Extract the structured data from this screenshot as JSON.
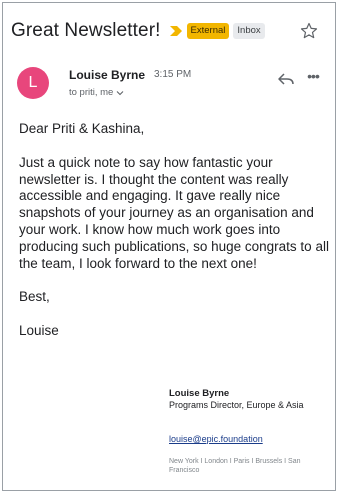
{
  "email": {
    "subject": "Great Newsletter!",
    "labels": {
      "external": "External",
      "inbox": "Inbox"
    },
    "sender": {
      "initial": "L",
      "name": "Louise Byrne",
      "time": "3:15 PM",
      "recipients": "to priti, me"
    },
    "body": {
      "greeting": "Dear Priti & Kashina,",
      "paragraph": "Just a quick note to say how fantastic your newsletter is. I thought the content was really accessible and engaging. It gave really nice snapshots of your journey as an organisation and your work. I know how much work goes into producing such publications, so huge congrats to all the team, I look forward to the next one!",
      "closing": "Best,",
      "signoff": "Louise"
    },
    "signature": {
      "name": "Louise Byrne",
      "title": "Programs Director, Europe & Asia",
      "email": "louise@epic.foundation",
      "offices": "New York I London I Paris I Brussels I San Francisco"
    }
  },
  "colors": {
    "avatar": "#e8467c",
    "external_badge": "#f2b600",
    "importance_marker": "#f2b600",
    "link": "#1a3c8a"
  },
  "icons": [
    "importance-marker-icon",
    "star-icon",
    "reply-icon",
    "more-options-icon",
    "chevron-down-icon"
  ]
}
